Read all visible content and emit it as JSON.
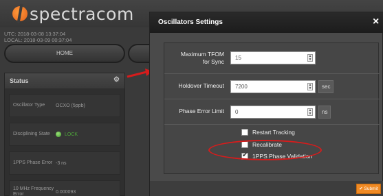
{
  "app": {
    "brand": "spectracom",
    "utc_time": "UTC: 2018-03-08 13:37:04",
    "local_time": "LOCAL: 2018-03-09 00:37:04",
    "nav_home": "HOME"
  },
  "status": {
    "title": "Status",
    "rows": [
      {
        "label": "Oscillator Type",
        "value": "OCXO (5ppb)"
      },
      {
        "label": "Disciplining State",
        "value": "LOCK"
      },
      {
        "label": "1PPS Phase Error",
        "value": "-3 ns"
      },
      {
        "label": "10 MHz Frequency Error",
        "value": "0.000093"
      }
    ]
  },
  "modal": {
    "title": "Oscillators Settings",
    "close": "×",
    "fields": {
      "max_tfom_label": "Maximum TFOM for Sync",
      "max_tfom_value": "15",
      "holdover_label": "Holdover Timeout",
      "holdover_value": "7200",
      "holdover_unit": "sec",
      "phase_error_label": "Phase Error Limit",
      "phase_error_value": "0",
      "phase_error_unit": "ns"
    },
    "checkboxes": [
      {
        "label": "Restart Tracking",
        "checked": false
      },
      {
        "label": "Recalibrate",
        "checked": false
      },
      {
        "label": "1PPS Phase Validation",
        "checked": true
      }
    ],
    "submit_label": "✔ Submit"
  },
  "colors": {
    "accent": "#f08a24",
    "highlight": "#d61c1c",
    "lock_green": "#4ea83a"
  }
}
